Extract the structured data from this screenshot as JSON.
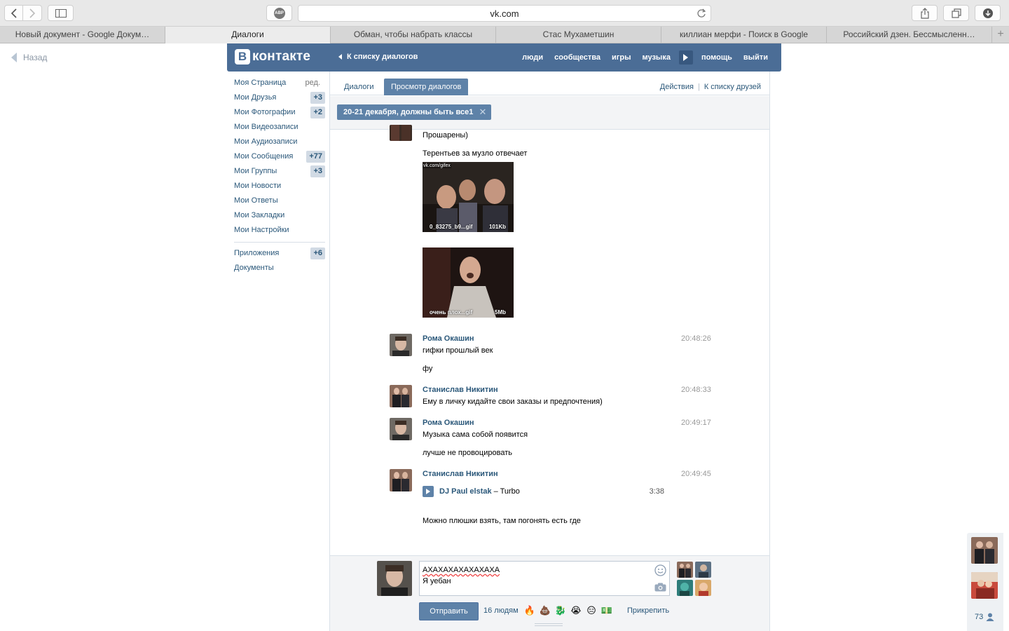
{
  "browser": {
    "url": "vk.com",
    "adblock_label": "ABP",
    "tabs": [
      {
        "label": "Новый документ - Google Докум…",
        "active": false
      },
      {
        "label": "Диалоги",
        "active": true
      },
      {
        "label": "Обман, чтобы набрать классы",
        "active": false
      },
      {
        "label": "Стас Мухаметшин",
        "active": false
      },
      {
        "label": "киллиан мерфи - Поиск в Google",
        "active": false
      },
      {
        "label": "Российский дзен. Бессмысленн…",
        "active": false
      }
    ],
    "new_tab": "+"
  },
  "page": {
    "back_label": "Назад"
  },
  "vk_header": {
    "logo_b": "В",
    "logo_text": "контакте",
    "back_to_dialogs": "К списку диалогов",
    "nav": [
      "люди",
      "сообщества",
      "игры",
      "музыка",
      "помощь",
      "выйти"
    ]
  },
  "sidebar": {
    "edit_label": "ред.",
    "items": [
      {
        "label": "Моя Страница",
        "count": ""
      },
      {
        "label": "Мои Друзья",
        "count": "+3"
      },
      {
        "label": "Мои Фотографии",
        "count": "+2"
      },
      {
        "label": "Мои Видеозаписи",
        "count": ""
      },
      {
        "label": "Мои Аудиозаписи",
        "count": ""
      },
      {
        "label": "Мои Сообщения",
        "count": "+77"
      },
      {
        "label": "Мои Группы",
        "count": "+3"
      },
      {
        "label": "Мои Новости",
        "count": ""
      },
      {
        "label": "Мои Ответы",
        "count": ""
      },
      {
        "label": "Мои Закладки",
        "count": ""
      },
      {
        "label": "Мои Настройки",
        "count": ""
      }
    ],
    "items2": [
      {
        "label": "Приложения",
        "count": "+6"
      },
      {
        "label": "Документы",
        "count": ""
      }
    ]
  },
  "main": {
    "tab_dialogs": "Диалоги",
    "tab_view": "Просмотр диалогов",
    "actions": "Действия",
    "friends_list": "К списку друзей",
    "chat_title": "20-21 декабря, должны быть все1",
    "chip_close": "✕"
  },
  "messages": {
    "m0_text1": "Прошарены)",
    "m0_text2": "Терентьев за музло отвечает",
    "gif1_url": "vk.com/gifex",
    "gif1_name": "0_83275_b9...gif",
    "gif1_size": "101Kb",
    "gif2_name": "очень плох...gif",
    "gif2_size": "5Mb",
    "m1_author": "Рома Окашин",
    "m1_time": "20:48:26",
    "m1_text1": "гифки прошлый век",
    "m1_text2": "фу",
    "m2_author": "Станислав Никитин",
    "m2_time": "20:48:33",
    "m2_text1": "Ему в личку кидайте свои заказы и предпочтения)",
    "m3_author": "Рома Окашин",
    "m3_time": "20:49:17",
    "m3_text1": "Музыка сама собой появится",
    "m3_text2": "лучше не провоцировать",
    "m4_author": "Станислав Никитин",
    "m4_time": "20:49:45",
    "audio_artist": "DJ Paul elstak",
    "audio_title": "– Turbo",
    "audio_duration": "3:38",
    "m4_text2": "Можно плюшки взять, там погонять есть где"
  },
  "composer": {
    "line1": "АХАХАХАХАХАХАХА",
    "line2": "Я уебан",
    "send_label": "Отправить",
    "people_label": "16 людям",
    "attach_label": "Прикрепить",
    "emojis": [
      "🔥",
      "💩",
      "🐉",
      "😭",
      "😑",
      "💵"
    ]
  },
  "right_panel": {
    "count": "73"
  },
  "colors": {
    "vk_blue": "#4b6d96",
    "link": "#2b587a",
    "button": "#5e82a8"
  }
}
